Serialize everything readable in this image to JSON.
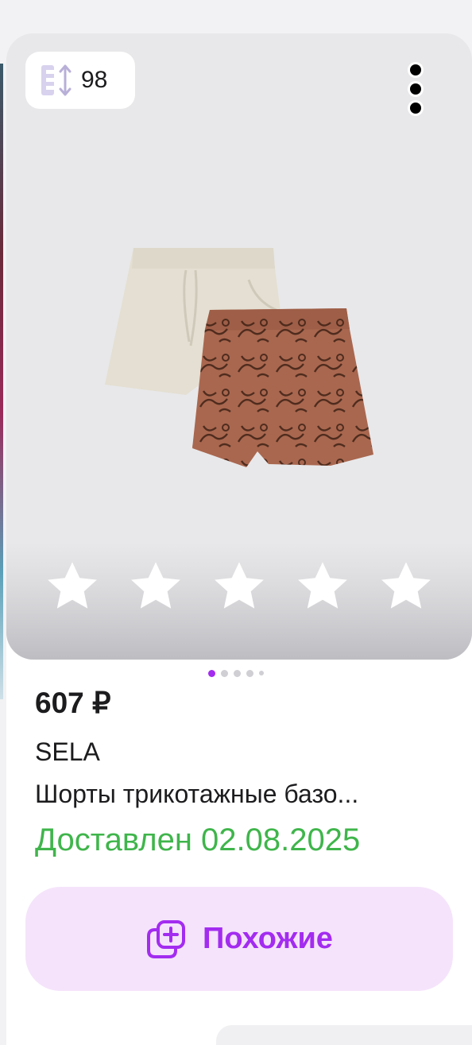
{
  "product": {
    "size_badge": {
      "icon": "size-range-icon",
      "value": "98"
    },
    "price": "607 ₽",
    "brand": "SELA",
    "title": "Шорты трикотажные базо...",
    "delivery_status": "Доставлен 02.08.2025",
    "rating": {
      "stars_total": 5,
      "stars_filled": 0
    },
    "gallery": {
      "total_images": 5,
      "active_index": 0
    }
  },
  "actions": {
    "similar_label": "Похожие",
    "similar_icon": "copy-plus-icon",
    "more_icon": "more-vertical-icon"
  },
  "colors": {
    "accent": "#a32cf0",
    "accent_bg": "#f5e3fb",
    "delivered": "#3fb54b",
    "text": "#1c1c1e"
  }
}
